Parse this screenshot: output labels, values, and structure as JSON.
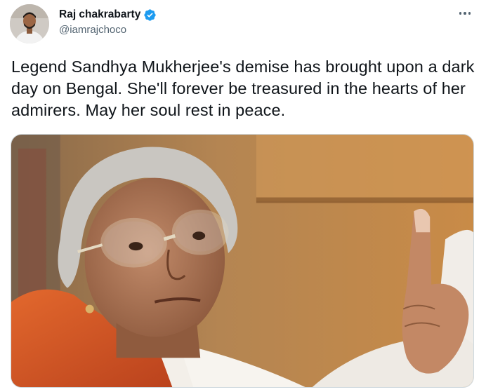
{
  "author": {
    "display_name": "Raj chakrabarty",
    "handle": "@iamrajchoco",
    "verified": true,
    "verified_color": "#1d9bf0"
  },
  "tweet": {
    "text": "Legend Sandhya Mukherjee's demise has brought upon a dark day on Bengal. She'll forever be treasured in the hearts of her admirers. May her soul rest in peace."
  },
  "icons": {
    "more": "more-options-icon",
    "verified": "verified-badge-icon"
  },
  "media": {
    "kind": "photo"
  }
}
